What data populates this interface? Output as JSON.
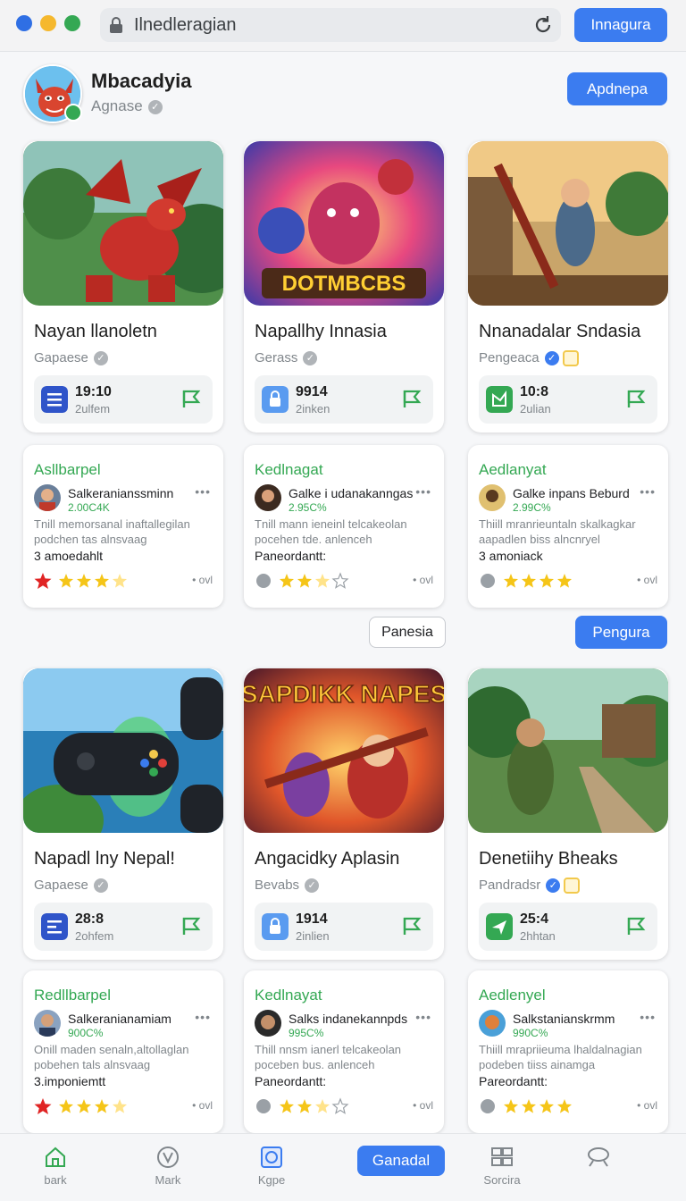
{
  "browser": {
    "url_text": "Ilnedleragian",
    "top_button": "Innagura"
  },
  "profile": {
    "name": "Mbacadyia",
    "subtitle": "Agnase",
    "action_button": "Apdnepa"
  },
  "colors": {
    "accent": "#3b7cf0",
    "green": "#34a853",
    "star": "#f5c518",
    "bg": "#f6f7f9"
  },
  "cards_row1": [
    {
      "title": "Nayan llanoletn",
      "category": "Gapaese",
      "verified": "grey",
      "stat_value": "19:10",
      "stat_sub": "2ulfem",
      "stat_icon": "list-icon",
      "art_text": ""
    },
    {
      "title": "Napallhy Innasia",
      "category": "Gerass",
      "verified": "grey",
      "stat_value": "9914",
      "stat_sub": "2inken",
      "stat_icon": "lock-icon",
      "art_text": "DOTMBCBS"
    },
    {
      "title": "Nnanadalar Sndasia",
      "category": "Pengeaca",
      "verified": "blue-gold",
      "stat_value": "10:8",
      "stat_sub": "2ulian",
      "stat_icon": "chart-icon",
      "art_text": ""
    }
  ],
  "reviews_row1": [
    {
      "heading": "Asllbarpel",
      "user": "Salkeranianssminn",
      "percent": "2.00C4K",
      "body": "Tnill memorsanal inaftallegilan podchen tas alnsvaag",
      "footer": "3 amoedahlt",
      "stars": "3",
      "dots": "• ovl"
    },
    {
      "heading": "Kedlnagat",
      "user": "Galke i udanakanngas",
      "percent": "2.95C%",
      "body": "Tnill mann ieneinl telcakeolan pocehen tde. anlenceh",
      "footer": "Paneordantt:",
      "stars": "2",
      "dots": "• ovl"
    },
    {
      "heading": "Aedlanyat",
      "user": "Galke inpans Beburd",
      "percent": "2.99C%",
      "body": "Thiill mranrieuntaln skalkagkar aapadlen biss alncnryel",
      "footer": "3 amoniack",
      "stars": "4",
      "dots": "• ovl"
    }
  ],
  "middle_buttons": {
    "outline": "Panesia",
    "primary": "Pengura"
  },
  "cards_row2": [
    {
      "title": "Napadl lny Nepal!",
      "category": "Gapaese",
      "verified": "grey",
      "stat_value": "28:8",
      "stat_sub": "2ohfem",
      "stat_icon": "list-icon",
      "art_text": ""
    },
    {
      "title": "Angacidky Aplasin",
      "category": "Bevabs",
      "verified": "grey",
      "stat_value": "1914",
      "stat_sub": "2inlien",
      "stat_icon": "lock-icon",
      "art_text": "SAPDIKK NAPES"
    },
    {
      "title": "Denetiihy Bheaks",
      "category": "Pandradsr",
      "verified": "blue-gold",
      "stat_value": "25:4",
      "stat_sub": "2hhtan",
      "stat_icon": "chart-icon",
      "art_text": ""
    }
  ],
  "reviews_row2": [
    {
      "heading": "Redllbarpel",
      "user": "Salkeranianamiam",
      "percent": "900C%",
      "body": "Onill maden senaln,altollaglan pobehen tals alnsvaag",
      "footer": "3.imponiemtt",
      "stars": "3",
      "dots": "• ovl"
    },
    {
      "heading": "Kedlnayat",
      "user": "Salks indanekannpds",
      "percent": "995C%",
      "body": "Thill nnsm ianerl telcakeolan poceben bus. anlenceh",
      "footer": "Paneordantt:",
      "stars": "2",
      "dots": "• ovl"
    },
    {
      "heading": "Aedlenyel",
      "user": "Salkstanianskrmm",
      "percent": "990C%",
      "body": "Thiill mrapriieuma lhaldalnagian podeben tiiss ainamga",
      "footer": "Pareordantt:",
      "stars": "4",
      "dots": "• ovl"
    }
  ],
  "bottom_nav": [
    {
      "label": "bark",
      "icon": "home-icon"
    },
    {
      "label": "Mark",
      "icon": "compass-icon"
    },
    {
      "label": "Kgpe",
      "icon": "gallery-icon"
    },
    {
      "label": "Ganadal",
      "icon": "primary-button"
    },
    {
      "label": "Sorcira",
      "icon": "grid-icon"
    },
    {
      "label": "",
      "icon": "search-icon"
    }
  ]
}
